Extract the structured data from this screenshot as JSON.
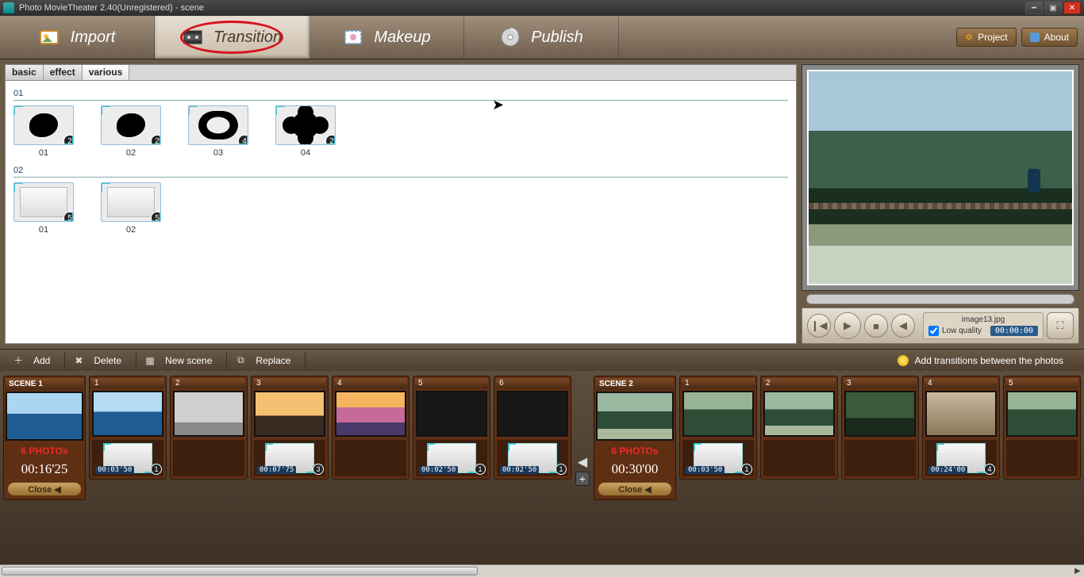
{
  "window_title": "Photo MovieTheater 2.40(Unregistered) - scene",
  "main_tabs": {
    "import": "Import",
    "transition": "Transition",
    "makeup": "Makeup",
    "publish": "Publish"
  },
  "topbuttons": {
    "project": "Project",
    "about": "About"
  },
  "subtabs": {
    "basic": "basic",
    "effect": "effect",
    "various": "various"
  },
  "library": {
    "groups": [
      {
        "id": "01",
        "items": [
          {
            "label": "01",
            "badge": "2",
            "shape": "splat"
          },
          {
            "label": "02",
            "badge": "2",
            "shape": "splat"
          },
          {
            "label": "03",
            "badge": "4",
            "shape": "pill"
          },
          {
            "label": "04",
            "badge": "2",
            "shape": "flower"
          }
        ]
      },
      {
        "id": "02",
        "items": [
          {
            "label": "01",
            "badge": "5",
            "shape": "blank"
          },
          {
            "label": "02",
            "badge": "5",
            "shape": "blank"
          }
        ]
      }
    ]
  },
  "preview": {
    "filename": "image13.jpg",
    "low_quality_label": "Low quality",
    "low_quality": true,
    "timecode": "00:00:00"
  },
  "toolbar2": {
    "add": "Add",
    "delete": "Delete",
    "newscene": "New scene",
    "replace": "Replace"
  },
  "hint": "Add transitions between the photos",
  "scenes": [
    {
      "title": "SCENE 1",
      "count": "6 PHOTOs",
      "duration": "00:16'25",
      "close": "Close",
      "imgclass": "s1",
      "clips": [
        {
          "n": "1",
          "img": "sea",
          "tc": "00:03'50",
          "badge": "1",
          "hastrans": true
        },
        {
          "n": "2",
          "img": "grey",
          "hastrans": false
        },
        {
          "n": "3",
          "img": "beach",
          "tc": "00:07'75",
          "badge": "3",
          "hastrans": true
        },
        {
          "n": "4",
          "img": "sunset",
          "hastrans": false
        },
        {
          "n": "5",
          "img": "dark",
          "tc": "00:02'50",
          "badge": "1",
          "hastrans": true
        },
        {
          "n": "6",
          "img": "dark",
          "tc": "00:02'50",
          "badge": "1",
          "hastrans": true
        }
      ]
    },
    {
      "title": "SCENE 2",
      "count": "6 PHOTOs",
      "duration": "00:30'00",
      "close": "Close",
      "imgclass": "s2",
      "clips": [
        {
          "n": "1",
          "img": "jungle",
          "tc": "00:03'50",
          "badge": "1",
          "hastrans": true
        },
        {
          "n": "2",
          "img": "bridge",
          "hastrans": false
        },
        {
          "n": "3",
          "img": "tree",
          "hastrans": false
        },
        {
          "n": "4",
          "img": "misc",
          "tc": "00:24'00",
          "badge": "4",
          "hastrans": true
        },
        {
          "n": "5",
          "img": "jungle",
          "hastrans": false
        }
      ]
    }
  ]
}
